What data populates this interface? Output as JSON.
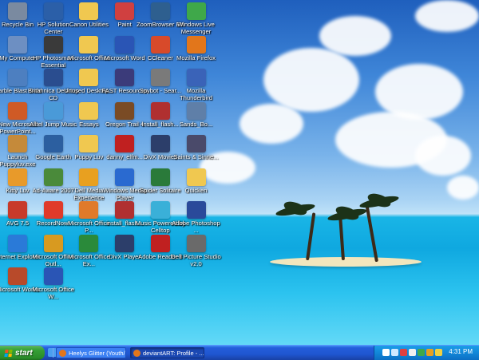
{
  "desktop": {
    "icons": [
      {
        "label": "Recycle Bin",
        "icon": "recycle-bin-icon",
        "color": "#7a8aa0"
      },
      {
        "label": "HP Solution Center",
        "icon": "hp-solution-center-icon",
        "color": "#2b5fa8"
      },
      {
        "label": "Canon Utilities",
        "icon": "folder-icon",
        "color": "#f0c850"
      },
      {
        "label": "Paint",
        "icon": "paint-icon",
        "color": "#d04040"
      },
      {
        "label": "ZoomBrowser EX",
        "icon": "zoombrowser-icon",
        "color": "#2e5f8f"
      },
      {
        "label": "Windows Live Messenger",
        "icon": "messenger-icon",
        "color": "#3fa84a"
      },
      {
        "label": "My Computer",
        "icon": "my-computer-icon",
        "color": "#6d8fc2"
      },
      {
        "label": "HP Photosmart Essential",
        "icon": "hp-photosmart-icon",
        "color": "#3a3a3a"
      },
      {
        "label": "Microsoft Office",
        "icon": "folder-icon",
        "color": "#f0c850"
      },
      {
        "label": "Microsoft Word",
        "icon": "word-icon",
        "color": "#2a55b5"
      },
      {
        "label": "CCleaner",
        "icon": "ccleaner-icon",
        "color": "#d84a2a"
      },
      {
        "label": "Mozilla Firefox",
        "icon": "firefox-icon",
        "color": "#e2761b"
      },
      {
        "label": "Marble Blast Gold",
        "icon": "marble-blast-icon",
        "color": "#4d7fc0"
      },
      {
        "label": "Britannica Desktop CD",
        "icon": "britannica-icon",
        "color": "#2a4d8f"
      },
      {
        "label": "Unused Desktop...",
        "icon": "folder-icon",
        "color": "#f0c850"
      },
      {
        "label": "FAST Resources",
        "icon": "fast-resources-icon",
        "color": "#3b3b7a"
      },
      {
        "label": "Spybot - Sear...",
        "icon": "spybot-icon",
        "color": "#7a7a7a"
      },
      {
        "label": "Mozilla Thunderbird",
        "icon": "thunderbird-icon",
        "color": "#3a63b8"
      },
      {
        "label": "New Microsoft PowerPoint...",
        "icon": "powerpoint-icon",
        "color": "#cf5a25"
      },
      {
        "label": "Alltel Jump Music",
        "icon": "music-icon",
        "color": "#4a9ad8"
      },
      {
        "label": "Essays",
        "icon": "folder-icon",
        "color": "#f0c850"
      },
      {
        "label": "Oregon Trail 4",
        "icon": "oregon-trail-icon",
        "color": "#7a4b25"
      },
      {
        "label": "install_flash...",
        "icon": "installer-icon",
        "color": "#b03030"
      },
      {
        "label": "Sands_Bo...",
        "icon": "image-file-icon",
        "color": "#5f7fa8"
      },
      {
        "label": "Launch Puppyluv.exe",
        "icon": "puppyluv-icon",
        "color": "#c58a3a"
      },
      {
        "label": "Google Earth",
        "icon": "google-earth-icon",
        "color": "#2c5fa0"
      },
      {
        "label": "Puppy Luv",
        "icon": "folder-icon",
        "color": "#f0c850"
      },
      {
        "label": "danny_elfm...",
        "icon": "pdf-icon",
        "color": "#c02020"
      },
      {
        "label": "DivX Movies",
        "icon": "divx-icon",
        "color": "#2c3e6a"
      },
      {
        "label": "Saints & Sinne...",
        "icon": "media-file-icon",
        "color": "#4a4a6a"
      },
      {
        "label": "Kitty Luv",
        "icon": "kitty-luv-icon",
        "color": "#e89a2a"
      },
      {
        "label": "Ad-Aware 2007",
        "icon": "ad-aware-icon",
        "color": "#4a8a3a"
      },
      {
        "label": "Dell Media Experience",
        "icon": "dell-media-icon",
        "color": "#e8a020"
      },
      {
        "label": "Windows Media Player",
        "icon": "media-player-icon",
        "color": "#2a6ad0"
      },
      {
        "label": "Spider Solitaire",
        "icon": "spider-solitaire-icon",
        "color": "#2a7a3a"
      },
      {
        "label": "Quicken",
        "icon": "folder-icon",
        "color": "#f0c850"
      },
      {
        "label": "AVG 7.5",
        "icon": "avg-icon",
        "color": "#c83a2a"
      },
      {
        "label": "RecordNow!",
        "icon": "recordnow-icon",
        "color": "#e03a2a"
      },
      {
        "label": "Microsoft Office P...",
        "icon": "office-icon",
        "color": "#e07a2a"
      },
      {
        "label": "install_flash...",
        "icon": "installer-icon",
        "color": "#b03030"
      },
      {
        "label": "Music Powered by Celltop",
        "icon": "music-icon",
        "color": "#3ab0d8"
      },
      {
        "label": "Adobe Photoshop ...",
        "icon": "photoshop-icon",
        "color": "#2a4a9a"
      },
      {
        "label": "Internet Explorer",
        "icon": "internet-explorer-icon",
        "color": "#2a7ad8"
      },
      {
        "label": "Microsoft Office Outl...",
        "icon": "outlook-icon",
        "color": "#d89a20"
      },
      {
        "label": "Microsoft Office Ex...",
        "icon": "excel-icon",
        "color": "#2a8a3a"
      },
      {
        "label": "DivX Player",
        "icon": "divx-player-icon",
        "color": "#2c3e6a"
      },
      {
        "label": "Adobe Reader 8",
        "icon": "adobe-reader-icon",
        "color": "#c02020"
      },
      {
        "label": "Dell Picture Studio v2.0",
        "icon": "dell-picture-studio-icon",
        "color": "#6a6a6a"
      },
      {
        "label": "Microsoft Works",
        "icon": "works-icon",
        "color": "#b84a2a"
      },
      {
        "label": "Microsoft Office W...",
        "icon": "word-icon",
        "color": "#2a55b5"
      }
    ]
  },
  "taskbar": {
    "start_label": "start",
    "quick_launch": [
      {
        "icon": "internet-explorer-icon",
        "color": "#4aa0f0"
      },
      {
        "icon": "show-desktop-icon",
        "color": "#d8c880"
      }
    ],
    "tasks": [
      {
        "label": "Heelys Glitter (Youth/...",
        "icon": "firefox-icon",
        "color": "#e2761b"
      },
      {
        "label": "deviantART: Profile - ...",
        "icon": "firefox-icon",
        "color": "#e2761b"
      }
    ],
    "tray_icons": [
      {
        "icon": "help-icon",
        "color": "#ffffff"
      },
      {
        "icon": "network-icon",
        "color": "#cfe8ff"
      },
      {
        "icon": "security-icon",
        "color": "#e04040"
      },
      {
        "icon": "volume-icon",
        "color": "#f0f0f0"
      },
      {
        "icon": "messenger-icon",
        "color": "#3fa84a"
      },
      {
        "icon": "antivirus-icon",
        "color": "#e8a020"
      },
      {
        "icon": "update-icon",
        "color": "#f0d040"
      }
    ],
    "clock": "4:31 PM"
  }
}
